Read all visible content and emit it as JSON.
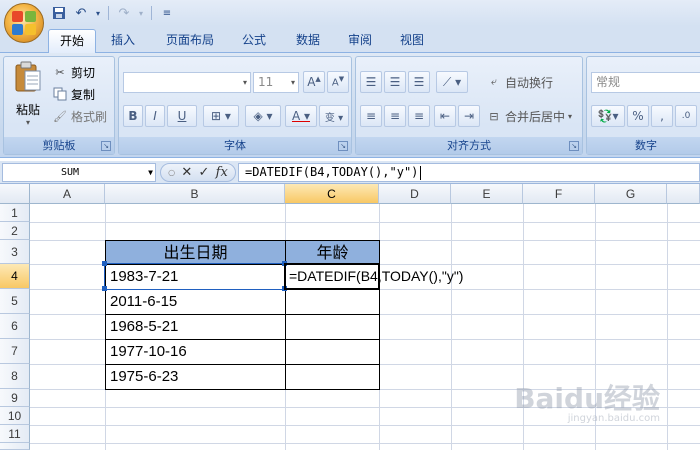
{
  "quick_access": {
    "icons": [
      "save-icon",
      "undo-icon",
      "redo-icon",
      "customize-icon"
    ]
  },
  "tabs": [
    {
      "label": "开始",
      "active": true
    },
    {
      "label": "插入",
      "active": false
    },
    {
      "label": "页面布局",
      "active": false
    },
    {
      "label": "公式",
      "active": false
    },
    {
      "label": "数据",
      "active": false
    },
    {
      "label": "审阅",
      "active": false
    },
    {
      "label": "视图",
      "active": false
    }
  ],
  "ribbon": {
    "clipboard": {
      "group_label": "剪贴板",
      "paste": "粘贴",
      "cut": "剪切",
      "copy": "复制",
      "format_painter": "格式刷"
    },
    "font": {
      "group_label": "字体",
      "font_name": "",
      "font_size": "11",
      "bold": "B",
      "italic": "I",
      "underline": "U"
    },
    "alignment": {
      "group_label": "对齐方式",
      "wrap_text": "自动换行",
      "merge_center": "合并后居中"
    },
    "number": {
      "group_label": "数字",
      "format": "常规",
      "percent": "%"
    }
  },
  "formula_bar": {
    "name_box": "SUM",
    "cancel": "✕",
    "enter": "✓",
    "fx": "fx",
    "formula": "=DATEDIF(B4,TODAY(),\"y\")"
  },
  "sheet": {
    "columns": [
      "A",
      "B",
      "C",
      "D",
      "E",
      "F",
      "G"
    ],
    "rows": [
      "1",
      "2",
      "3",
      "4",
      "5",
      "6",
      "7",
      "8",
      "9",
      "10",
      "11"
    ],
    "selected_column": "C",
    "selected_row": "4",
    "table_header": {
      "B3": "出生日期",
      "C3": "年龄"
    },
    "birth_dates": [
      "1983-7-21",
      "2011-6-15",
      "1968-5-21",
      "1977-10-16",
      "1975-6-23"
    ],
    "editing_cell_text": "=DATEDIF(B4,TODAY(),\"y\")"
  },
  "watermark": {
    "text": "Baidu经验",
    "sub": "jingyan.baidu.com"
  },
  "colors": {
    "header_fill": "#8fb0dd",
    "selection_header": "#f8c865",
    "ribbon_bg": "#dfe9f5"
  }
}
